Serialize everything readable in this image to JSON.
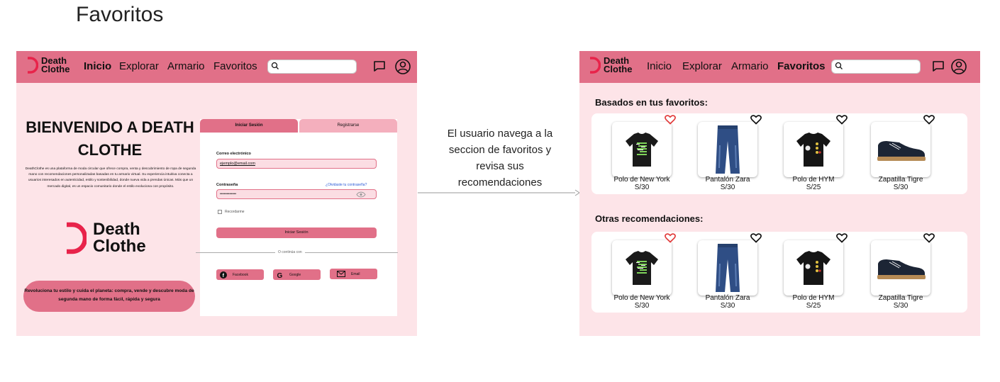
{
  "page_title": "Favoritos",
  "caption": "El usuario navega a la seccion de favoritos y revisa sus recomendaciones",
  "brand": {
    "line1": "Death",
    "line2": "Clothe",
    "accent": "#e17088",
    "light": "#fde4e8"
  },
  "nav": {
    "inicio": "Inicio",
    "explorar": "Explorar",
    "armario": "Armario",
    "favoritos": "Favoritos",
    "search_value": ""
  },
  "login_screen": {
    "welcome": "BIENVENIDO A DEATH CLOTHE",
    "intro": "DeathClothe es una plataforma de moda circular que ofrece compra, venta y descubrimiento de ropa de segunda mano con recomendaciones personalizadas basadas en tu armario virtual. Su experiencia intuitiva conecta a usuarios interesados en autenticidad, estilo y sostenibilidad, donde nueva vida a prendas únicas. Más que un mercado digital, es un espacio comunitario donde el estilo evoluciona con propósito.",
    "slogan": "Revoluciona tu estilo y cuida el planeta: compra, vende y descubre moda de segunda mano de forma fácil, rápida y segura",
    "tab_login": "Iniciar Sesión",
    "tab_register": "Registrarse",
    "email_label": "Correo electrónico",
    "email_value": "ejemplo@email.com",
    "password_label": "Contraseña",
    "password_value": "••••••••••••",
    "forgot": "¿Olvidaste tu contraseña?",
    "remember": "Recordarme",
    "submit": "Iniciar Sesión",
    "divider": "O continúa con",
    "facebook": "Facebook",
    "google": "Google",
    "email_btn": "Email"
  },
  "favorites_screen": {
    "section1_title": "Basados en tus favoritos:",
    "section2_title": "Otras recomendaciones:",
    "products": [
      {
        "name": "Polo de New York",
        "price": "S/30",
        "favorited": true
      },
      {
        "name": "Pantalón Zara",
        "price": "S/30",
        "favorited": false
      },
      {
        "name": "Polo de HYM",
        "price": "S/25",
        "favorited": false
      },
      {
        "name": "Zapatilla Tigre",
        "price": "S/30",
        "favorited": false
      }
    ]
  }
}
